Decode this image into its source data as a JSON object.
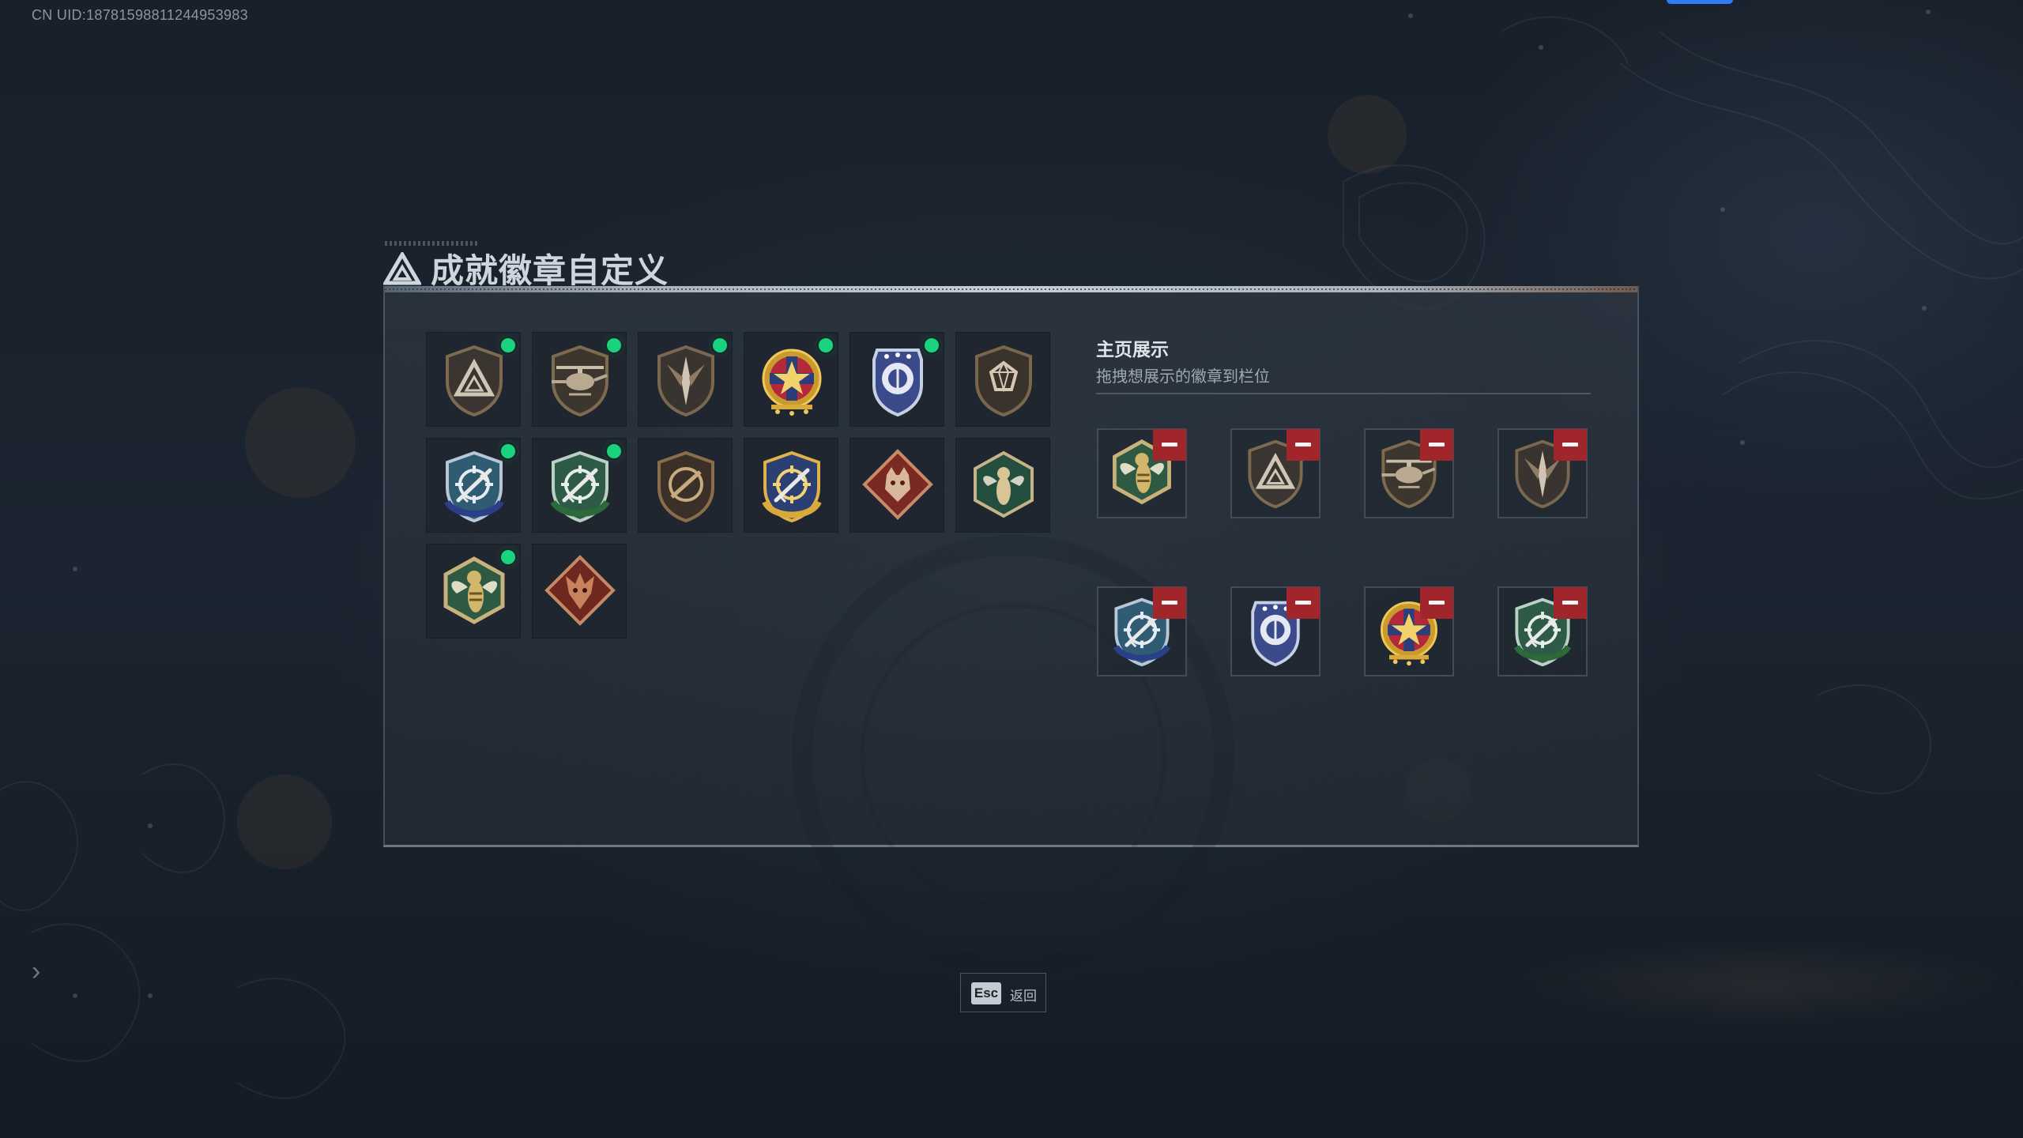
{
  "uid": "CN UID:18781598811244953983",
  "window": {
    "title": "成就徽章自定义"
  },
  "badges": [
    {
      "name": "triangle-emblem-badge-icon",
      "is_new": true
    },
    {
      "name": "helicopter-badge-icon",
      "is_new": true
    },
    {
      "name": "dagger-wings-badge-icon",
      "is_new": true
    },
    {
      "name": "star-medal-badge-icon",
      "is_new": true
    },
    {
      "name": "police-shield-badge-icon",
      "is_new": true
    },
    {
      "name": "gem-shield-badge-icon",
      "is_new": false
    },
    {
      "name": "blue-crosshair-shield-badge-icon",
      "is_new": true
    },
    {
      "name": "green-crosshair-shield-badge-icon",
      "is_new": true
    },
    {
      "name": "bronze-rifle-shield-badge-icon",
      "is_new": false
    },
    {
      "name": "gold-crosshair-shield-badge-icon",
      "is_new": false
    },
    {
      "name": "red-wolf-diamond-badge-icon",
      "is_new": false
    },
    {
      "name": "green-wasp-hexagon-badge-icon",
      "is_new": false
    },
    {
      "name": "wasp-hexagon-badge-icon",
      "is_new": true
    },
    {
      "name": "red-dragon-diamond-badge-icon",
      "is_new": false
    }
  ],
  "showcase": {
    "title": "主页展示",
    "subtitle": "拖拽想展示的徽章到栏位",
    "slots": [
      {
        "name": "wasp-hexagon-badge-icon"
      },
      {
        "name": "triangle-emblem-badge-icon"
      },
      {
        "name": "helicopter-badge-icon"
      },
      {
        "name": "dagger-wings-badge-icon"
      },
      {
        "name": "blue-crosshair-shield-badge-icon"
      },
      {
        "name": "police-shield-badge-icon"
      },
      {
        "name": "star-medal-badge-icon"
      },
      {
        "name": "green-crosshair-shield-badge-icon"
      }
    ]
  },
  "footer": {
    "esc_key": "Esc",
    "esc_label": "返回"
  },
  "colors": {
    "new_dot": "#19d37f",
    "remove_button": "#a1262b",
    "accent_blue": "#2f7cf6"
  }
}
